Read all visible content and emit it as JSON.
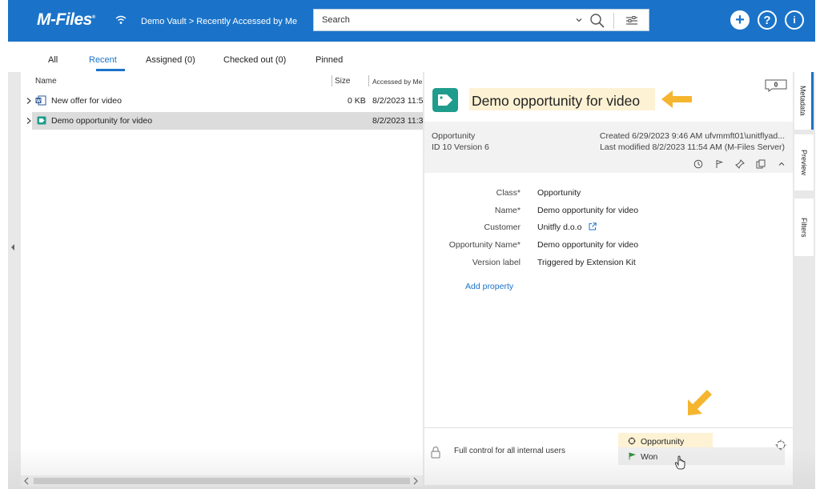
{
  "app": {
    "logo": "M-Files",
    "breadcrumb": "Demo Vault > Recently Accessed by Me"
  },
  "search": {
    "placeholder": "Search"
  },
  "top_icons": [
    "add-icon",
    "help-icon",
    "info-icon"
  ],
  "tabs": [
    {
      "label": "All"
    },
    {
      "label": "Recent"
    },
    {
      "label": "Assigned (0)"
    },
    {
      "label": "Checked out (0)"
    },
    {
      "label": "Pinned"
    }
  ],
  "list": {
    "columns": {
      "name": "Name",
      "size": "Size",
      "accessed": "Accessed by Me"
    },
    "rows": [
      {
        "name": "New offer for video",
        "size": "0 KB",
        "accessed": "8/2/2023 11:5",
        "icon": "word-document-icon"
      },
      {
        "name": "Demo opportunity for video",
        "size": "",
        "accessed": "8/2/2023 11:3",
        "icon": "opportunity-icon"
      }
    ]
  },
  "object": {
    "title": "Demo opportunity for video",
    "comment_count": "0",
    "class_name": "Opportunity",
    "id_version": "ID 10  Version 6",
    "created": "Created 6/29/2023 9:46 AM ufvmmft01\\unitflyad...",
    "modified": "Last modified 8/2/2023 11:54 AM (M-Files Server)",
    "properties": [
      {
        "label": "Class*",
        "value": "Opportunity"
      },
      {
        "label": "Name*",
        "value": "Demo opportunity for video"
      },
      {
        "label": "Customer",
        "value": "Unitfly d.o.o"
      },
      {
        "label": "Opportunity Name*",
        "value": "Demo opportunity for video"
      },
      {
        "label": "Version label",
        "value": "Triggered by Extension Kit"
      }
    ],
    "add_property": "Add property",
    "permissions": "Full control for all internal users",
    "workflow": "Opportunity",
    "state": "Won"
  },
  "side_tabs": [
    {
      "label": "Metadata"
    },
    {
      "label": "Preview"
    },
    {
      "label": "Filters"
    }
  ],
  "colors": {
    "brand": "#1a73c9",
    "object_icon": "#1f9c8b",
    "highlight": "#fdf2d4",
    "annotation_arrow": "#f5b52e"
  }
}
